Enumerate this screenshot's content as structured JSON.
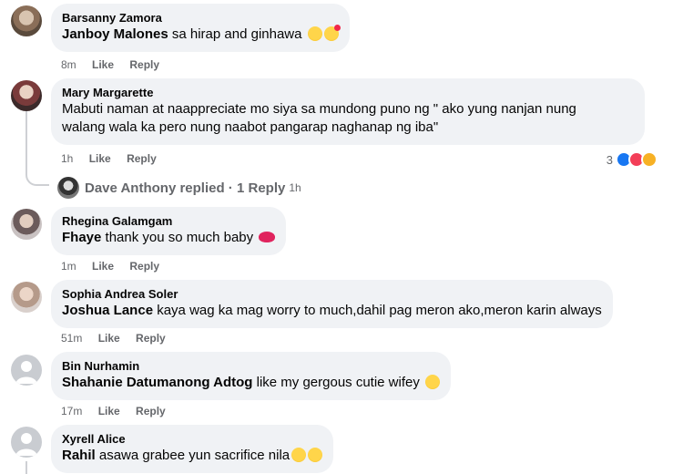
{
  "comments": [
    {
      "author": "Barsanny Zamora",
      "tag": "Janboy Malones",
      "text": " sa hirap and ginhawa",
      "time": "8m",
      "like": "Like",
      "reply": "Reply"
    },
    {
      "author": "Mary Margarette",
      "line1": "Mabuti naman at naappreciate mo siya sa mundong puno ng \" ako yung nanjan nung",
      "line2": "walang wala ka pero nung naabot pangarap naghanap ng iba\"",
      "time": "1h",
      "like": "Like",
      "reply": "Reply",
      "reaction_count": "3"
    },
    {
      "author": "Rhegina Galamgam",
      "tag": "Fhaye",
      "text": " thank you so much baby",
      "time": "1m",
      "like": "Like",
      "reply": "Reply"
    },
    {
      "author": "Sophia Andrea Soler",
      "tag": "Joshua Lance",
      "text": " kaya wag ka mag worry to much,dahil pag meron ako,meron karin always",
      "time": "51m",
      "like": "Like",
      "reply": "Reply"
    },
    {
      "author": "Bin Nurhamin",
      "tag": "Shahanie Datumanong Adtog",
      "text": " like my gergous cutie wifey",
      "time": "17m",
      "like": "Like",
      "reply": "Reply"
    },
    {
      "author": "Xyrell Alice",
      "tag": "Rahil",
      "text": " asawa grabee yun sacrifice nila",
      "time": "",
      "like": "",
      "reply": ""
    }
  ],
  "replies": {
    "label": "Dave Anthony replied · 1 Reply",
    "time": "1h"
  },
  "icons": {
    "reaction_like": "thumbs-up-reaction-icon",
    "reaction_love": "heart-reaction-icon",
    "reaction_care": "care-reaction-icon"
  },
  "colors": {
    "bubble": "#f0f2f5",
    "meta_text": "#65676b",
    "like_blue": "#1877f2",
    "love_red": "#f33e58"
  }
}
